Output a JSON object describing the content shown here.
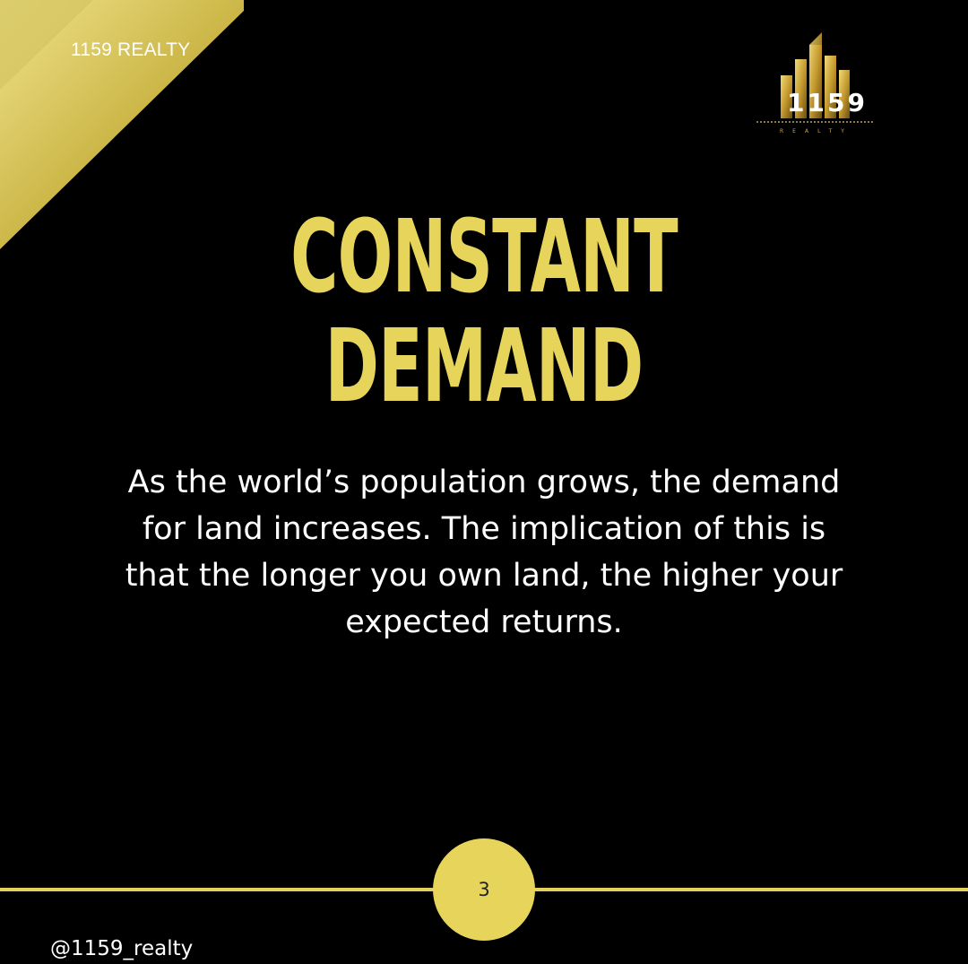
{
  "brand": {
    "top_label": "1159 REALTY",
    "logo_number": "1159",
    "logo_subtitle": "REALTY"
  },
  "headline": {
    "line1": "CONSTANT",
    "line2": "DEMAND"
  },
  "body": {
    "text": "As the world’s population grows, the demand for land increases. The implication of this is that the longer you own land, the higher your expected returns."
  },
  "footer": {
    "page_number": "3",
    "handle": "@1159_realty"
  },
  "colors": {
    "background": "#000000",
    "accent": "#e7d45a",
    "text": "#ffffff"
  }
}
